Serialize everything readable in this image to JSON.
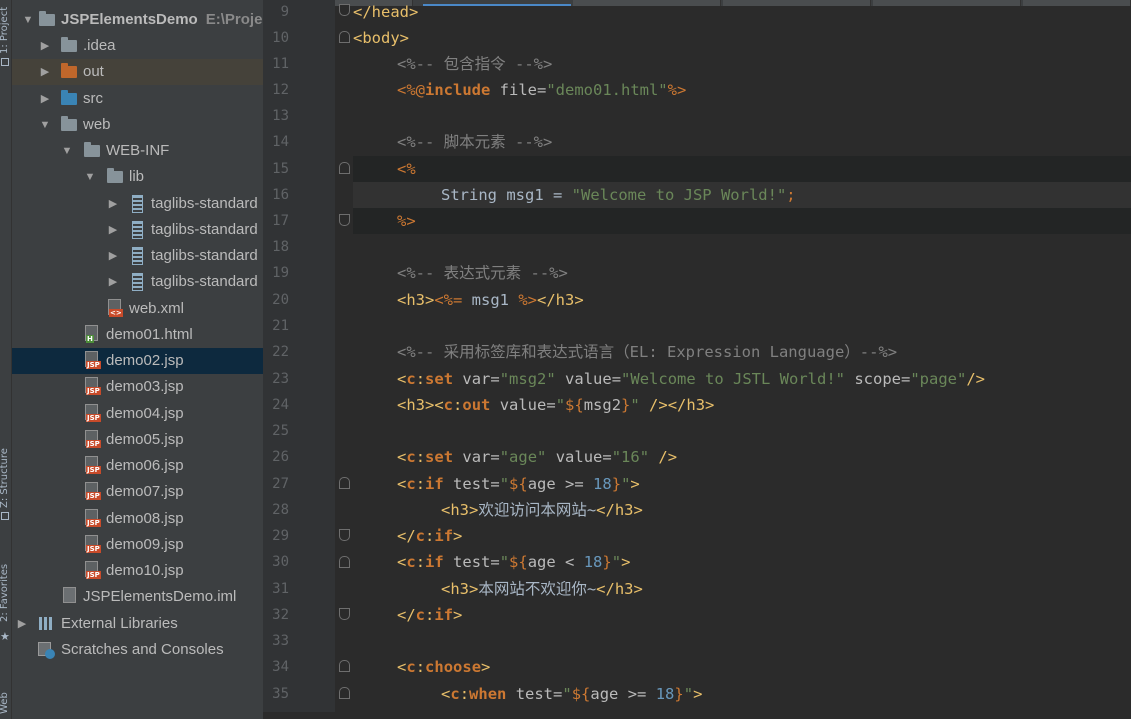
{
  "tool_windows": {
    "project_tab": "1: Project",
    "structure_tab": "Z: Structure",
    "favorites_tab": "2: Favorites",
    "web_tab": "Web"
  },
  "project_tree": {
    "root_name": "JSPElementsDemo",
    "root_path": "E:\\Proje",
    "idea": ".idea",
    "out": "out",
    "src": "src",
    "web": "web",
    "web_inf": "WEB-INF",
    "lib": "lib",
    "jars": [
      "taglibs-standard",
      "taglibs-standard",
      "taglibs-standard",
      "taglibs-standard"
    ],
    "web_xml": "web.xml",
    "files": [
      "demo01.html",
      "demo02.jsp",
      "demo03.jsp",
      "demo04.jsp",
      "demo05.jsp",
      "demo06.jsp",
      "demo07.jsp",
      "demo08.jsp",
      "demo09.jsp",
      "demo10.jsp"
    ],
    "iml": "JSPElementsDemo.iml",
    "external_libraries": "External Libraries",
    "scratches": "Scratches and Consoles"
  },
  "editor": {
    "line_numbers": [
      "9",
      "10",
      "11",
      "12",
      "13",
      "14",
      "15",
      "16",
      "17",
      "18",
      "19",
      "20",
      "21",
      "22",
      "23",
      "24",
      "25",
      "26",
      "27",
      "28",
      "29",
      "30",
      "31",
      "32",
      "33",
      "34",
      "35"
    ],
    "lines": {
      "l9": "</head>",
      "l10": "<body>",
      "l11": "<%-- 包含指令 --%>",
      "l12_a": "<%@",
      "l12_b": "include",
      "l12_c": " file=",
      "l12_d": "\"demo01.html\"",
      "l12_e": "%>",
      "l14": "<%-- 脚本元素 --%>",
      "l15": "<%",
      "l16_a": "String msg1 = ",
      "l16_b": "\"Welcome to JSP World!\"",
      "l16_c": ";",
      "l17": "%>",
      "l19": "<%-- 表达式元素 --%>",
      "l20_a": "<h3>",
      "l20_b": "<%=",
      "l20_c": " msg1 ",
      "l20_d": "%>",
      "l20_e": "</h3>",
      "l22": "<%-- 采用标签库和表达式语言（EL: Expression Language）--%>",
      "l23_text": "<c:set var=\"msg2\" value=\"Welcome to JSTL World!\" scope=\"page\"/>",
      "l24_text": "<h3><c:out value=\"${msg2}\" /></h3>",
      "l26_text": "<c:set var=\"age\" value=\"16\" />",
      "l27_text": "<c:if test=\"${age >= 18}\">",
      "l28_a": "<h3>",
      "l28_b": "欢迎访问本网站~",
      "l28_c": "</h3>",
      "l29": "</c:if>",
      "l30_text": "<c:if test=\"${age < 18}\">",
      "l31_a": "<h3>",
      "l31_b": "本网站不欢迎你~",
      "l31_c": "</h3>",
      "l32": "</c:if>",
      "l34": "<c:choose>",
      "l35_text": "<c:when test=\"${age >= 18}\">"
    }
  },
  "colors": {
    "tag": "#e8bf6a",
    "string": "#6a8759",
    "comment": "#808080",
    "keyword": "#cc7832",
    "number": "#6897bb",
    "selected_row": "#0d293e"
  }
}
